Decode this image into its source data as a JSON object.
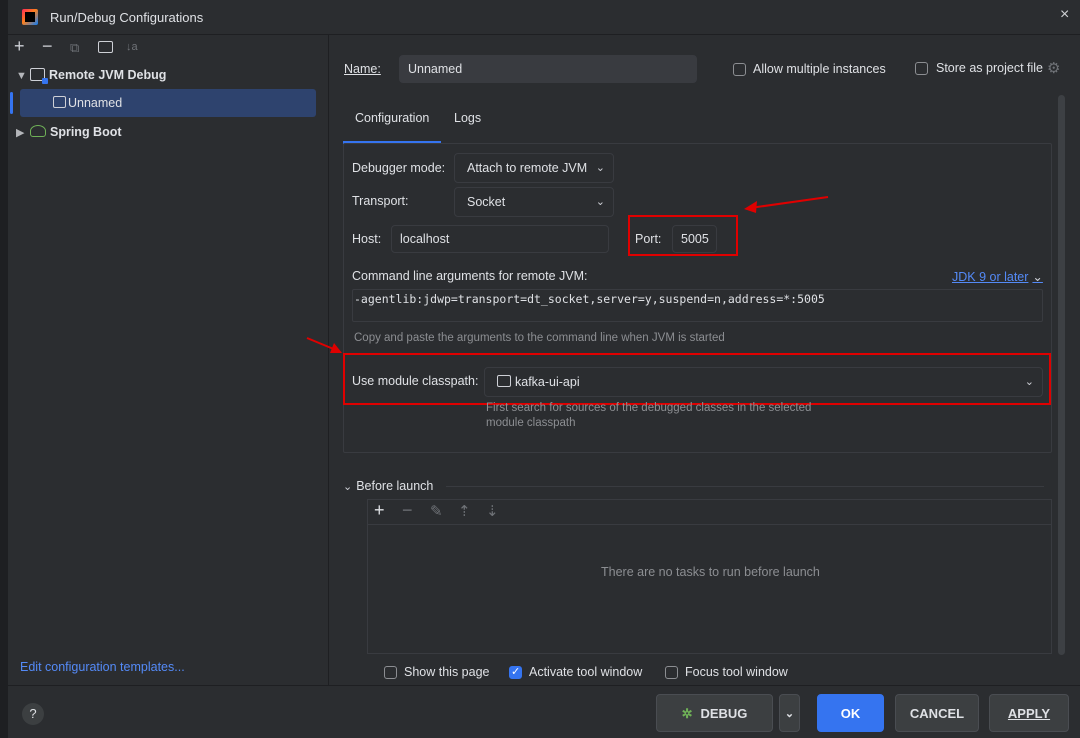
{
  "window": {
    "title": "Run/Debug Configurations",
    "close_label": "×"
  },
  "toolbar": {
    "add": "+",
    "remove": "−",
    "copy": "⧉",
    "folder": "🗀",
    "sort": "↓a"
  },
  "tree": {
    "groups": [
      {
        "label": "Remote JVM Debug",
        "expanded": true,
        "children": [
          "Unnamed"
        ]
      },
      {
        "label": "Spring Boot",
        "expanded": false
      }
    ],
    "selected": "Unnamed"
  },
  "edit_templates_link": "Edit configuration templates...",
  "form": {
    "name_label": "Name:",
    "name_value": "Unnamed",
    "allow_multiple_label": "Allow multiple instances",
    "allow_multiple_checked": false,
    "store_as_file_label": "Store as project file",
    "store_as_file_checked": false,
    "tabs": [
      "Configuration",
      "Logs"
    ],
    "active_tab": "Configuration",
    "debugger_mode_label": "Debugger mode:",
    "debugger_mode_value": "Attach to remote JVM",
    "transport_label": "Transport:",
    "transport_value": "Socket",
    "host_label": "Host:",
    "host_value": "localhost",
    "port_label": "Port:",
    "port_value": "5005",
    "cmd_args_label": "Command line arguments for remote JVM:",
    "jdk_link": "JDK 9 or later",
    "cmd_args_value": "-agentlib:jdwp=transport=dt_socket,server=y,suspend=n,address=*:5005",
    "cmd_hint": "Copy and paste the arguments to the command line when JVM is started",
    "module_classpath_label": "Use module classpath:",
    "module_classpath_value": "kafka-ui-api",
    "module_hint_line1": "First search for sources of the debugged classes in the selected",
    "module_hint_line2": "module classpath",
    "before_launch_label": "Before launch",
    "no_tasks_text": "There are no tasks to run before launch",
    "show_page_label": "Show this page",
    "show_page_checked": false,
    "activate_tool_label": "Activate tool window",
    "activate_tool_checked": true,
    "focus_tool_label": "Focus tool window",
    "focus_tool_checked": false
  },
  "buttons": {
    "help": "?",
    "debug": "DEBUG",
    "ok": "OK",
    "cancel": "CANCEL",
    "apply": "APPLY"
  },
  "colors": {
    "background": "#2b2d30",
    "accent": "#3574f0",
    "annotation_red": "#e00000"
  },
  "icons": [
    "app-icon",
    "close-icon",
    "add-icon",
    "remove-icon",
    "copy-icon",
    "folder-icon",
    "sort-icon",
    "remote-debug-icon",
    "spring-boot-icon",
    "gear-icon",
    "module-icon",
    "debug-bug-icon",
    "help-icon"
  ]
}
